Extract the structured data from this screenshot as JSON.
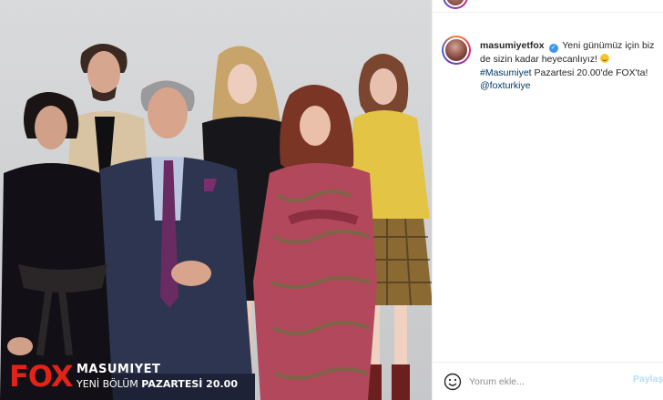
{
  "post": {
    "brand_logo": "FOX",
    "show_title": "MASUMIYET",
    "show_subtitle_prefix": "YENİ BÖLÜM",
    "show_subtitle_bold": "PAZARTESİ 20.00"
  },
  "caption": {
    "username": "masumiyetfox",
    "verified_icon": "verified-badge-icon",
    "text_1": "Yeni günümüz için biz de sizin kadar heyecanlıyız!",
    "emoji": "smiling-face-icon",
    "hashtag": "#Masumiyet",
    "text_2": "Pazartesi 20.00'de FOX'ta!",
    "mention": "@foxturkiye"
  },
  "comment_box": {
    "emoji_icon": "smiley-icon",
    "placeholder": "Yorum ekle...",
    "post_label": "Paylaş"
  },
  "colors": {
    "link": "#00376b",
    "verified": "#3897f0",
    "fox_red": "#e2231a",
    "post_disabled": "#b2dffc"
  }
}
